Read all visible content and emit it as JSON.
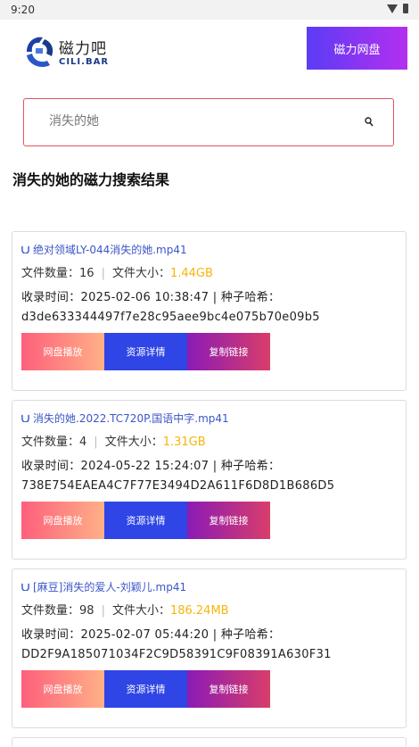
{
  "status_bar": {
    "time": "9:20"
  },
  "header": {
    "logo_name": "磁力吧",
    "logo_sub": "CILI.BAR",
    "cloud_button": "磁力网盘"
  },
  "search": {
    "placeholder": "消失的她"
  },
  "page_title": "消失的她的磁力搜索结果",
  "labels": {
    "file_count": "文件数量：",
    "file_size": "文件大小：",
    "indexed_time": "收录时间：",
    "hash": "种子哈希：",
    "play_button": "网盘播放",
    "detail_button": "资源详情",
    "copy_button": "复制链接"
  },
  "results": [
    {
      "title": "绝对领域LY-044消失的她.mp41",
      "count": "16",
      "size": "1.44GB",
      "time": "2025-02-06 10:38:47",
      "hash": "d3de633344497f7e28c95aee9bc4e075b70e09b5"
    },
    {
      "title": "消失的她.2022.TC720P.国语中字.mp41",
      "count": "4",
      "size": "1.31GB",
      "time": "2024-05-22 15:24:07",
      "hash": "738E754EAEA4C7F77E3494D2A611F6D8D1B686D5"
    },
    {
      "title": "[麻豆]消失的爱人-刘颖儿.mp41",
      "count": "98",
      "size": "186.24MB",
      "time": "2025-02-07 05:44:20",
      "hash": "DD2F9A185071034F2C9D58391C9F08391A630F31"
    }
  ],
  "icons": {
    "magnet": "magnet-icon",
    "search": "search-icon",
    "wifi": "wifi-icon",
    "battery": "battery-icon"
  },
  "colors": {
    "accent_blue": "#2f45e6",
    "title_link": "#3b55c9",
    "size_highlight": "#f5b50a",
    "search_border": "#e2535b"
  }
}
